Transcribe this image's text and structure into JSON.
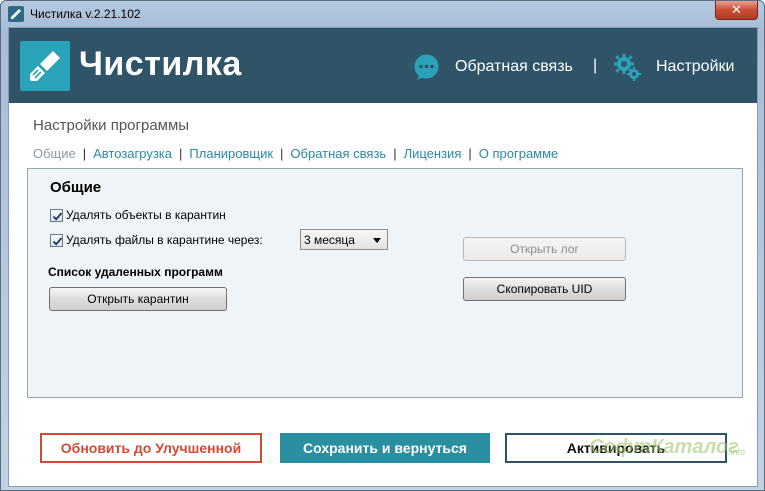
{
  "window": {
    "title": "Чистилка v.2.21.102",
    "close_glyph": "✕"
  },
  "header": {
    "logo_text": "Чистилка",
    "feedback_label": "Обратная связь",
    "separator": "|",
    "settings_label": "Настройки"
  },
  "page": {
    "title": "Настройки программы"
  },
  "tabs": [
    {
      "label": "Общие",
      "active": true
    },
    {
      "label": "Автозагрузка"
    },
    {
      "label": "Планировщик"
    },
    {
      "label": "Обратная связь"
    },
    {
      "label": "Лицензия"
    },
    {
      "label": "О программе"
    }
  ],
  "tab_separator": "|",
  "general": {
    "title": "Общие",
    "delete_objects_label": "Удалять объекты в карантин",
    "delete_objects_checked": true,
    "delete_files_label": "Удалять файлы в карантине через:",
    "delete_files_checked": true,
    "period_value": "3 месяца",
    "removed_programs_title": "Список удаленных программ",
    "open_quarantine_label": "Открыть карантин",
    "open_log_label": "Открыть лог",
    "copy_uid_label": "Скопировать UID"
  },
  "footer": {
    "upgrade_label": "Обновить до Улучшенной",
    "save_label": "Сохранить и вернуться",
    "activate_label": "Активировать",
    "watermark": "СофтКаталог",
    "watermark_suffix": ".info"
  },
  "colors": {
    "header_bg": "#2f5468",
    "accent": "#2aa2b8",
    "link": "#2a8aa3",
    "upgrade_red": "#d24a36",
    "save_teal": "#2a8fa1"
  }
}
